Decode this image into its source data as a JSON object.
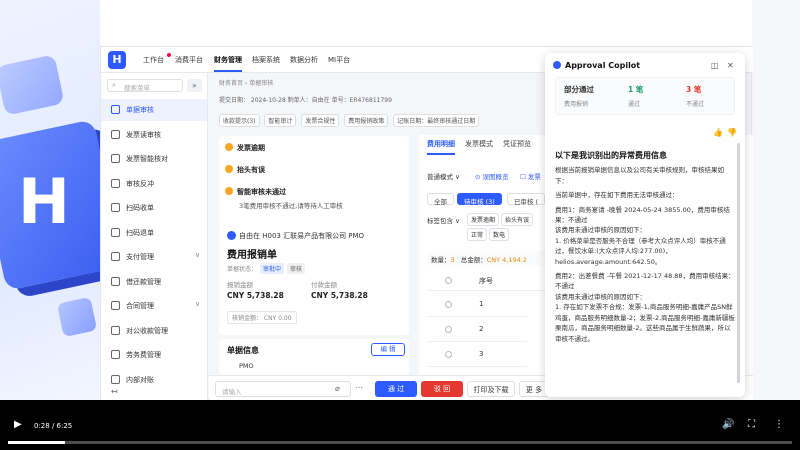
{
  "topnav": {
    "logo": "H",
    "items": [
      "工作台",
      "消费平台",
      "财务管理",
      "档案系统",
      "数据分析",
      "MI平台"
    ],
    "active_index": 2
  },
  "sidebar": {
    "search_placeholder": "搜索菜单",
    "collapse": "»",
    "items": [
      {
        "label": "单据审核",
        "arrow": ""
      },
      {
        "label": "发票读审核",
        "arrow": ""
      },
      {
        "label": "发票智能核对",
        "arrow": ""
      },
      {
        "label": "审核反冲",
        "arrow": ""
      },
      {
        "label": "扫码收单",
        "arrow": ""
      },
      {
        "label": "扫码退单",
        "arrow": ""
      },
      {
        "label": "支付管理",
        "arrow": "∨"
      },
      {
        "label": "借还款管理",
        "arrow": ""
      },
      {
        "label": "合同管理",
        "arrow": "∨"
      },
      {
        "label": "对公收款管理",
        "arrow": ""
      },
      {
        "label": "劳务费管理",
        "arrow": ""
      },
      {
        "label": "内部对账",
        "arrow": ""
      }
    ],
    "active_index": 0,
    "back": "↤"
  },
  "main": {
    "breadcrumb": "财务首页  ›  单据审核",
    "meta": "提交日期： 2024-10-28   制单人：自由在   单号：ER476811799",
    "tags": [
      "收款提示(3)",
      "智能审计",
      "发票合规性",
      "费用报销政策",
      "记账日期：最终审核通过日期"
    ],
    "alerts": {
      "rows": [
        {
          "text": "发票逾期"
        },
        {
          "text": "抬头有误"
        },
        {
          "text": "智能审核未通过"
        }
      ],
      "sub": "3笔费用审核不通过,请等待人工审核"
    },
    "info": {
      "company": "自由在 H003 汇联易产品有限公司 PMO",
      "title": "费用报销单",
      "state_label": "单据状态：",
      "state_badge1": "审批中",
      "state_badge2": "审核",
      "amt1_label": "报销金额",
      "amt1": "CNY 5,738.28",
      "amt2_label": "付款金额",
      "amt2": "CNY 5,738.28",
      "check_amount": "核销金额： CNY 0.00"
    },
    "doc_info": {
      "title": "单据信息",
      "edit": "编 辑",
      "value": "PMO"
    },
    "panel": {
      "tabs": [
        "费用明细",
        "发票模式",
        "凭证预览"
      ],
      "mode": "普通模式 ∨",
      "overview": "⊙ 误图概览",
      "extra": "☐ 发票",
      "pills": [
        "全部",
        "待审核 (3)",
        "已审核 ("
      ],
      "filter_label": "标签包含 ∨",
      "filter_tags": [
        "发票逾期",
        "抬头有误",
        "正常",
        "数电"
      ],
      "count_text": "数量：",
      "count_val": "3",
      "total_text": "总金额：",
      "total_val": "CNY 4,194.2",
      "col_seq": "序号",
      "rows": [
        "1",
        "2",
        "3"
      ]
    }
  },
  "footer": {
    "input_placeholder": "请输入",
    "approve": "通 过",
    "reject": "驳 回",
    "print": "打印及下载",
    "more": "更 多"
  },
  "copilot": {
    "title": "Approval Copilot",
    "stats": [
      {
        "label": "费用报销",
        "value": "部分通过",
        "color": "#111"
      },
      {
        "label": "通过",
        "value": "1 笔",
        "color": "#22a06b"
      },
      {
        "label": "不通过",
        "value": "3 笔",
        "color": "#e5382f"
      }
    ],
    "heading": "以下是我识别出的异常费用信息",
    "paragraphs": [
      "根据当前报销单据信息以及公司有关审核规则，审核结果如下：",
      "当前单据中，存在如下费用无法审核通过：",
      "费用1：商务宴请 -晚餐 2024-05-24 3855.00，费用审核结果：不通过",
      "该费用未通过审核的原因如下：",
      "1. 价格菜单是否服务不合理（参考大众点评人均）审核不通过，餐饮水单:(大众点评人均:277.00)，helios.average.amount:642.50。",
      "费用2：出差餐费 -午餐 2021-12-17 48.88，费用审核结果：不通过",
      "该费用未通过审核的原因如下：",
      "1. 存在如下发票不合规：发票-1,商品服务明细-嘉庸产品SN鲜鸡蛋，商品服务明细数量-2；发票-2,商品服务明细-嘉庸新疆板栗南瓜，商品服务明细数量-2。这些商品属于生鲜蔬果，所以审核不通过。"
    ]
  },
  "player": {
    "time": "0:28 / 6:25",
    "progress": 0.073
  }
}
